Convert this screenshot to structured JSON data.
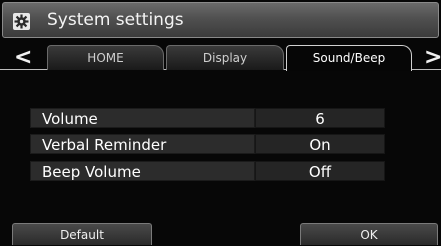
{
  "header": {
    "title": "System settings",
    "icon": "gear-icon"
  },
  "tabs": [
    {
      "label": "HOME",
      "active": false
    },
    {
      "label": "Display",
      "active": false
    },
    {
      "label": "Sound/Beep",
      "active": true
    }
  ],
  "nav": {
    "prev_icon": "chevron-left-icon",
    "next_icon": "chevron-right-icon",
    "prev_glyph": "<",
    "next_glyph": ">"
  },
  "settings": [
    {
      "label": "Volume",
      "value": "6"
    },
    {
      "label": "Verbal Reminder",
      "value": "On"
    },
    {
      "label": "Beep Volume",
      "value": "Off"
    }
  ],
  "footer": {
    "default_label": "Default",
    "ok_label": "OK"
  }
}
